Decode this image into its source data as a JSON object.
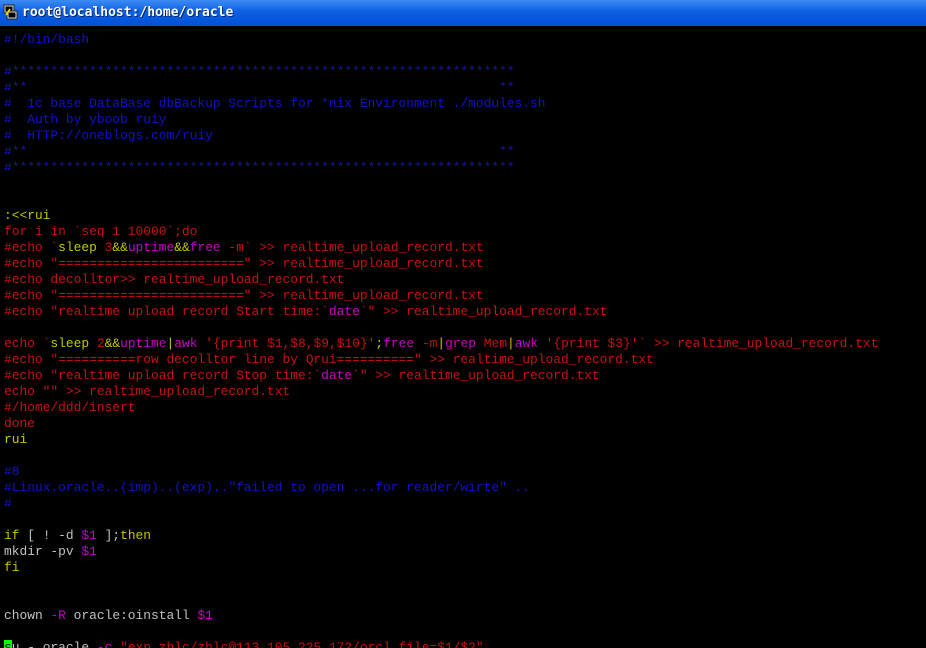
{
  "window": {
    "title": "root@localhost:/home/oracle",
    "icon": "putty-terminal-icon"
  },
  "colors": {
    "comment": "#1212c8",
    "keyword": "#c5c500",
    "string": "#c81212",
    "special": "#c800c8",
    "text": "#c0c0c0",
    "cursor": "#00ff00",
    "background": "#000000"
  },
  "lines": [
    {
      "name": "line-shebang",
      "segs": [
        {
          "c": "comment",
          "t": "#!/bin/bash"
        }
      ]
    },
    {
      "name": "line-blank",
      "segs": []
    },
    {
      "name": "line-comment",
      "segs": [
        {
          "c": "comment",
          "t": "#*****************************************************************"
        }
      ]
    },
    {
      "name": "line-comment",
      "segs": [
        {
          "c": "comment",
          "t": "#**                                                             **"
        }
      ]
    },
    {
      "name": "line-comment",
      "segs": [
        {
          "c": "comment",
          "t": "#  1c base DataBase dbBackup Scripts for *nix Environment ./modules.sh"
        }
      ]
    },
    {
      "name": "line-comment",
      "segs": [
        {
          "c": "comment",
          "t": "#  Auth by yboob ruiy"
        }
      ]
    },
    {
      "name": "line-comment",
      "segs": [
        {
          "c": "comment",
          "t": "#  HTTP://oneblogs.com/ruiy"
        }
      ]
    },
    {
      "name": "line-comment",
      "segs": [
        {
          "c": "comment",
          "t": "#**                                                             **"
        }
      ]
    },
    {
      "name": "line-comment",
      "segs": [
        {
          "c": "comment",
          "t": "#*****************************************************************"
        }
      ]
    },
    {
      "name": "line-blank",
      "segs": []
    },
    {
      "name": "line-blank",
      "segs": []
    },
    {
      "name": "line-heredoc",
      "segs": [
        {
          "c": "keyword",
          "t": ":<<rui"
        }
      ]
    },
    {
      "name": "line-for",
      "segs": [
        {
          "c": "string",
          "t": "for i in `seq 1 10000`;do"
        }
      ]
    },
    {
      "name": "line-echo",
      "segs": [
        {
          "c": "string",
          "t": "#echo `"
        },
        {
          "c": "keyword",
          "t": "sleep"
        },
        {
          "c": "string",
          "t": " 3"
        },
        {
          "c": "keyword",
          "t": "&&"
        },
        {
          "c": "special",
          "t": "uptime"
        },
        {
          "c": "keyword",
          "t": "&&"
        },
        {
          "c": "special",
          "t": "free"
        },
        {
          "c": "string",
          "t": " -m` >> realtime_upload_record.txt"
        }
      ]
    },
    {
      "name": "line-echo",
      "segs": [
        {
          "c": "string",
          "t": "#echo \"========================\" >> realtime_upload_record.txt"
        }
      ]
    },
    {
      "name": "line-echo",
      "segs": [
        {
          "c": "string",
          "t": "#echo decolltor>> realtime_upload_record.txt"
        }
      ]
    },
    {
      "name": "line-echo",
      "segs": [
        {
          "c": "string",
          "t": "#echo \"========================\" >> realtime_upload_record.txt"
        }
      ]
    },
    {
      "name": "line-echo",
      "segs": [
        {
          "c": "string",
          "t": "#echo \"realtime upload record Start time:`"
        },
        {
          "c": "special",
          "t": "date"
        },
        {
          "c": "string",
          "t": "`\" >> realtime_upload_record.txt"
        }
      ]
    },
    {
      "name": "line-blank",
      "segs": []
    },
    {
      "name": "line-echo",
      "segs": [
        {
          "c": "string",
          "t": "echo `"
        },
        {
          "c": "keyword",
          "t": "sleep"
        },
        {
          "c": "string",
          "t": " 2"
        },
        {
          "c": "keyword",
          "t": "&&"
        },
        {
          "c": "special",
          "t": "uptime"
        },
        {
          "c": "keyword",
          "t": "|"
        },
        {
          "c": "special",
          "t": "awk"
        },
        {
          "c": "string",
          "t": " '{print $1,$8,$9,$10}'"
        },
        {
          "c": "keyword",
          "t": ";"
        },
        {
          "c": "special",
          "t": "free"
        },
        {
          "c": "string",
          "t": " -m"
        },
        {
          "c": "keyword",
          "t": "|"
        },
        {
          "c": "special",
          "t": "grep"
        },
        {
          "c": "string",
          "t": " Mem"
        },
        {
          "c": "keyword",
          "t": "|"
        },
        {
          "c": "special",
          "t": "awk"
        },
        {
          "c": "string",
          "t": " '{print $3}'` >> realtime_upload_record.txt"
        }
      ]
    },
    {
      "name": "line-echo",
      "segs": [
        {
          "c": "string",
          "t": "#echo \"==========row decolltor line by Qrui==========\" >> realtime_upload_record.txt"
        }
      ]
    },
    {
      "name": "line-echo",
      "segs": [
        {
          "c": "string",
          "t": "#echo \"realtime upload record Stop time:`"
        },
        {
          "c": "special",
          "t": "date"
        },
        {
          "c": "string",
          "t": "`\" >> realtime_upload_record.txt"
        }
      ]
    },
    {
      "name": "line-echo",
      "segs": [
        {
          "c": "string",
          "t": "echo \"\" >> realtime_upload_record.txt"
        }
      ]
    },
    {
      "name": "line-path",
      "segs": [
        {
          "c": "string",
          "t": "#/home/ddd/insert"
        }
      ]
    },
    {
      "name": "line-done",
      "segs": [
        {
          "c": "string",
          "t": "done"
        }
      ]
    },
    {
      "name": "line-heredoc-end",
      "segs": [
        {
          "c": "keyword",
          "t": "rui"
        }
      ]
    },
    {
      "name": "line-blank",
      "segs": []
    },
    {
      "name": "line-comment",
      "segs": [
        {
          "c": "comment",
          "t": "#8"
        }
      ]
    },
    {
      "name": "line-comment",
      "segs": [
        {
          "c": "comment",
          "t": "#Linux.oracle..(imp)..(exp)..\"failed to open ...for reader/wirte\" .."
        }
      ]
    },
    {
      "name": "line-comment",
      "segs": [
        {
          "c": "comment",
          "t": "#"
        }
      ]
    },
    {
      "name": "line-blank",
      "segs": []
    },
    {
      "name": "line-if",
      "segs": [
        {
          "c": "keyword",
          "t": "if"
        },
        {
          "c": "text",
          "t": " [ ! -d "
        },
        {
          "c": "special",
          "t": "$1"
        },
        {
          "c": "text",
          "t": " ];"
        },
        {
          "c": "keyword",
          "t": "then"
        }
      ]
    },
    {
      "name": "line-mkdir",
      "segs": [
        {
          "c": "text",
          "t": "mkdir -pv "
        },
        {
          "c": "special",
          "t": "$1"
        }
      ]
    },
    {
      "name": "line-fi",
      "segs": [
        {
          "c": "keyword",
          "t": "fi"
        }
      ]
    },
    {
      "name": "line-blank",
      "segs": []
    },
    {
      "name": "line-blank",
      "segs": []
    },
    {
      "name": "line-chown",
      "segs": [
        {
          "c": "text",
          "t": "chown "
        },
        {
          "c": "special",
          "t": "-R"
        },
        {
          "c": "text",
          "t": " oracle:oinstall "
        },
        {
          "c": "special",
          "t": "$1"
        }
      ]
    },
    {
      "name": "line-blank",
      "segs": []
    },
    {
      "name": "line-su",
      "segs": [
        {
          "c": "cursor",
          "t": "s"
        },
        {
          "c": "text",
          "t": "u - oracle "
        },
        {
          "c": "special",
          "t": "-c"
        },
        {
          "c": "text",
          "t": " "
        },
        {
          "c": "string",
          "t": "\"exp zhlc/zhlc@113.105.225.172/orcl file=$1/$2\""
        }
      ]
    },
    {
      "name": "line-tilde",
      "segs": [
        {
          "c": "comment",
          "t": "~"
        }
      ]
    }
  ]
}
